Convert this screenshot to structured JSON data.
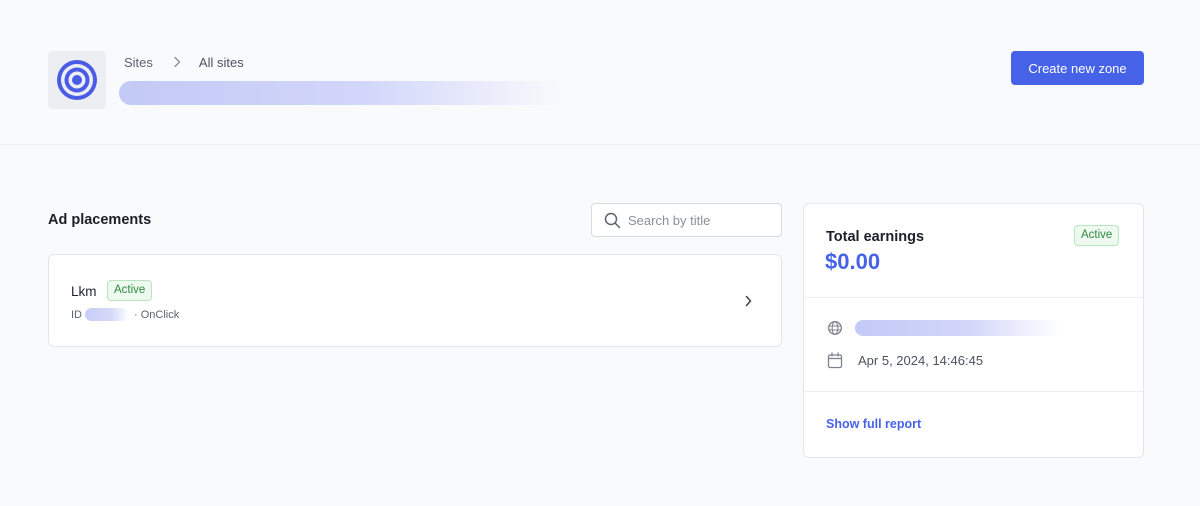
{
  "header": {
    "breadcrumb": {
      "root": "Sites",
      "current": "All sites"
    },
    "create_button": "Create new zone"
  },
  "placements": {
    "title": "Ad placements",
    "search": {
      "placeholder": "Search by title",
      "value": ""
    },
    "items": [
      {
        "name": "Lkm",
        "status": "Active",
        "id_label": "ID",
        "type": "· OnClick"
      }
    ]
  },
  "earnings": {
    "label": "Total earnings",
    "value": "$0.00",
    "status": "Active",
    "date": "Apr 5, 2024, 14:46:45",
    "report_link": "Show full report"
  },
  "colors": {
    "accent": "#4663e8",
    "active_badge_bg": "#eef9ef",
    "active_badge_text": "#2f8a3f",
    "background": "#f9fafc"
  },
  "icons": {
    "logo": "target-logo-icon",
    "breadcrumb_separator": "chevron-right-icon",
    "search": "search-icon",
    "placement_open": "chevron-right-icon",
    "url": "globe-icon",
    "date": "calendar-icon"
  }
}
